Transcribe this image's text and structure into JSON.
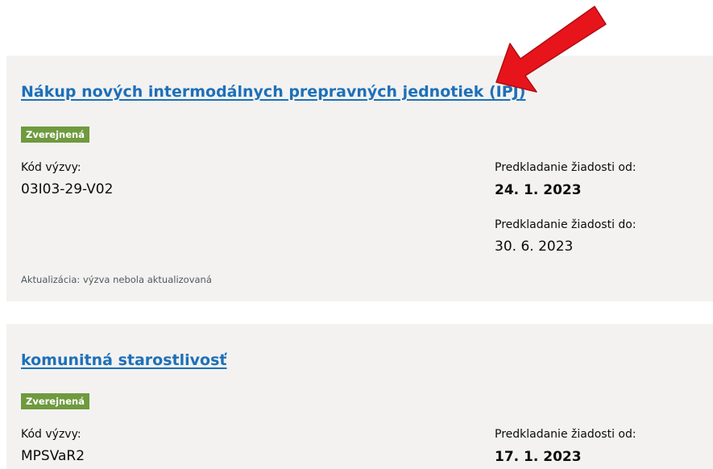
{
  "calls": [
    {
      "title": "Nákup nových intermodálnych prepravných jednotiek (IPJ)",
      "status": "Zverejnená",
      "code_label": "Kód výzvy:",
      "code_value": "03I03-29-V02",
      "from_label": "Predkladanie žiadosti od:",
      "from_value": "24. 1. 2023",
      "to_label": "Predkladanie žiadosti do:",
      "to_value": "30. 6. 2023",
      "update_text": "Aktualizácia: výzva nebola aktualizovaná"
    },
    {
      "title": "komunitná starostlivosť",
      "status": "Zverejnená",
      "code_label": "Kód výzvy:",
      "code_value": "MPSVaR2",
      "from_label": "Predkladanie žiadosti od:",
      "from_value": "17. 1. 2023"
    }
  ],
  "colors": {
    "link": "#1d70b8",
    "badge": "#6f9a3e",
    "card_bg": "#f3f2f1",
    "annotation_arrow": "#e8141b"
  },
  "icons": {
    "annotation": "red-arrow-icon"
  }
}
